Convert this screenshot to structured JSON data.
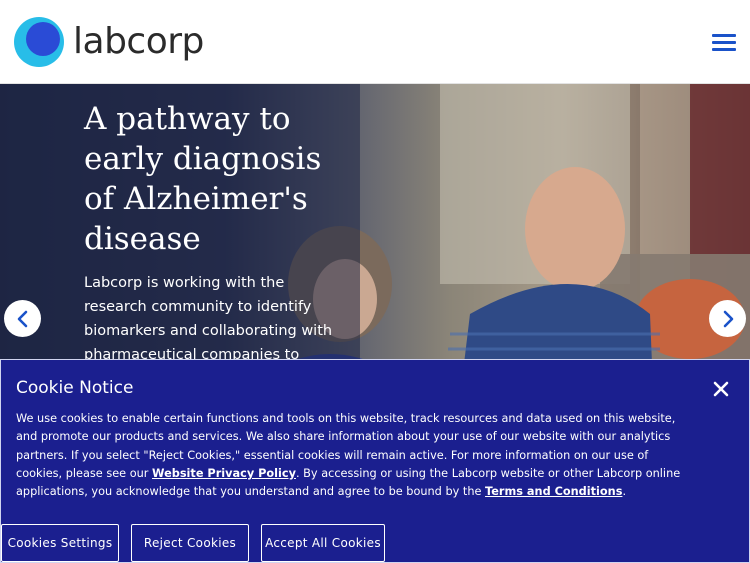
{
  "brand": {
    "name": "labcorp",
    "colors": {
      "accent": "#1a52c9",
      "cookie_bg": "#1b1f8f",
      "logo_outer": "#28bde8",
      "logo_inner": "#2a4bd6"
    }
  },
  "header": {
    "menu_icon": "hamburger-menu-icon"
  },
  "hero": {
    "title": "A pathway to early diagnosis of Alzheimer's disease",
    "body": "Labcorp is working with the research community to identify biomarkers and collaborating with pharmaceutical companies to",
    "prev_icon": "chevron-left-icon",
    "next_icon": "chevron-right-icon"
  },
  "cookie_notice": {
    "title": "Cookie Notice",
    "close_icon": "close-icon",
    "text_part1": "We use cookies to enable certain functions and tools on this website, track resources and data used on this website, and promote our products and services. We also share information about your use of our website with our analytics partners. If you select \"Reject Cookies,\" essential cookies will remain active. For more information on our use of cookies, please see our ",
    "privacy_link": "Website Privacy Policy",
    "text_part2": ". By accessing or using the Labcorp website or other Labcorp online applications, you acknowledge that you understand and agree to be bound by the ",
    "terms_link": "Terms and Conditions",
    "text_part3": ".",
    "buttons": {
      "settings": "Cookies Settings",
      "reject": "Reject Cookies",
      "accept": "Accept All Cookies"
    }
  }
}
